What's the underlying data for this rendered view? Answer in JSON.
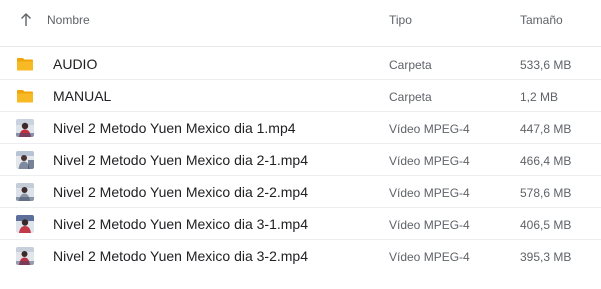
{
  "header": {
    "name_label": "Nombre",
    "type_label": "Tipo",
    "size_label": "Tamaño",
    "sort_icon": "arrow-up-icon"
  },
  "colors": {
    "folder": "#f7b924",
    "folder_tab": "#f0a50f",
    "divider": "#eceef1",
    "text_primary": "#202124",
    "text_secondary": "#5f6368"
  },
  "rows": [
    {
      "name": "AUDIO",
      "type": "Carpeta",
      "size": "533,6 MB",
      "icon": "folder-icon"
    },
    {
      "name": "MANUAL",
      "type": "Carpeta",
      "size": "1,2 MB",
      "icon": "folder-icon"
    },
    {
      "name": "Nivel 2 Metodo Yuen Mexico dia 1.mp4",
      "type": "Vídeo MPEG-4",
      "size": "447,8 MB",
      "icon": "video-thumbnail-icon"
    },
    {
      "name": "Nivel 2 Metodo Yuen Mexico dia 2-1.mp4",
      "type": "Vídeo MPEG-4",
      "size": "466,4 MB",
      "icon": "video-thumbnail-icon"
    },
    {
      "name": "Nivel 2 Metodo Yuen Mexico dia 2-2.mp4",
      "type": "Vídeo MPEG-4",
      "size": "578,6 MB",
      "icon": "video-thumbnail-icon"
    },
    {
      "name": "Nivel 2 Metodo Yuen Mexico dia 3-1.mp4",
      "type": "Vídeo MPEG-4",
      "size": "406,5 MB",
      "icon": "video-thumbnail-icon"
    },
    {
      "name": "Nivel 2 Metodo Yuen Mexico dia 3-2.mp4",
      "type": "Vídeo MPEG-4",
      "size": "395,3 MB",
      "icon": "video-thumbnail-icon"
    }
  ]
}
